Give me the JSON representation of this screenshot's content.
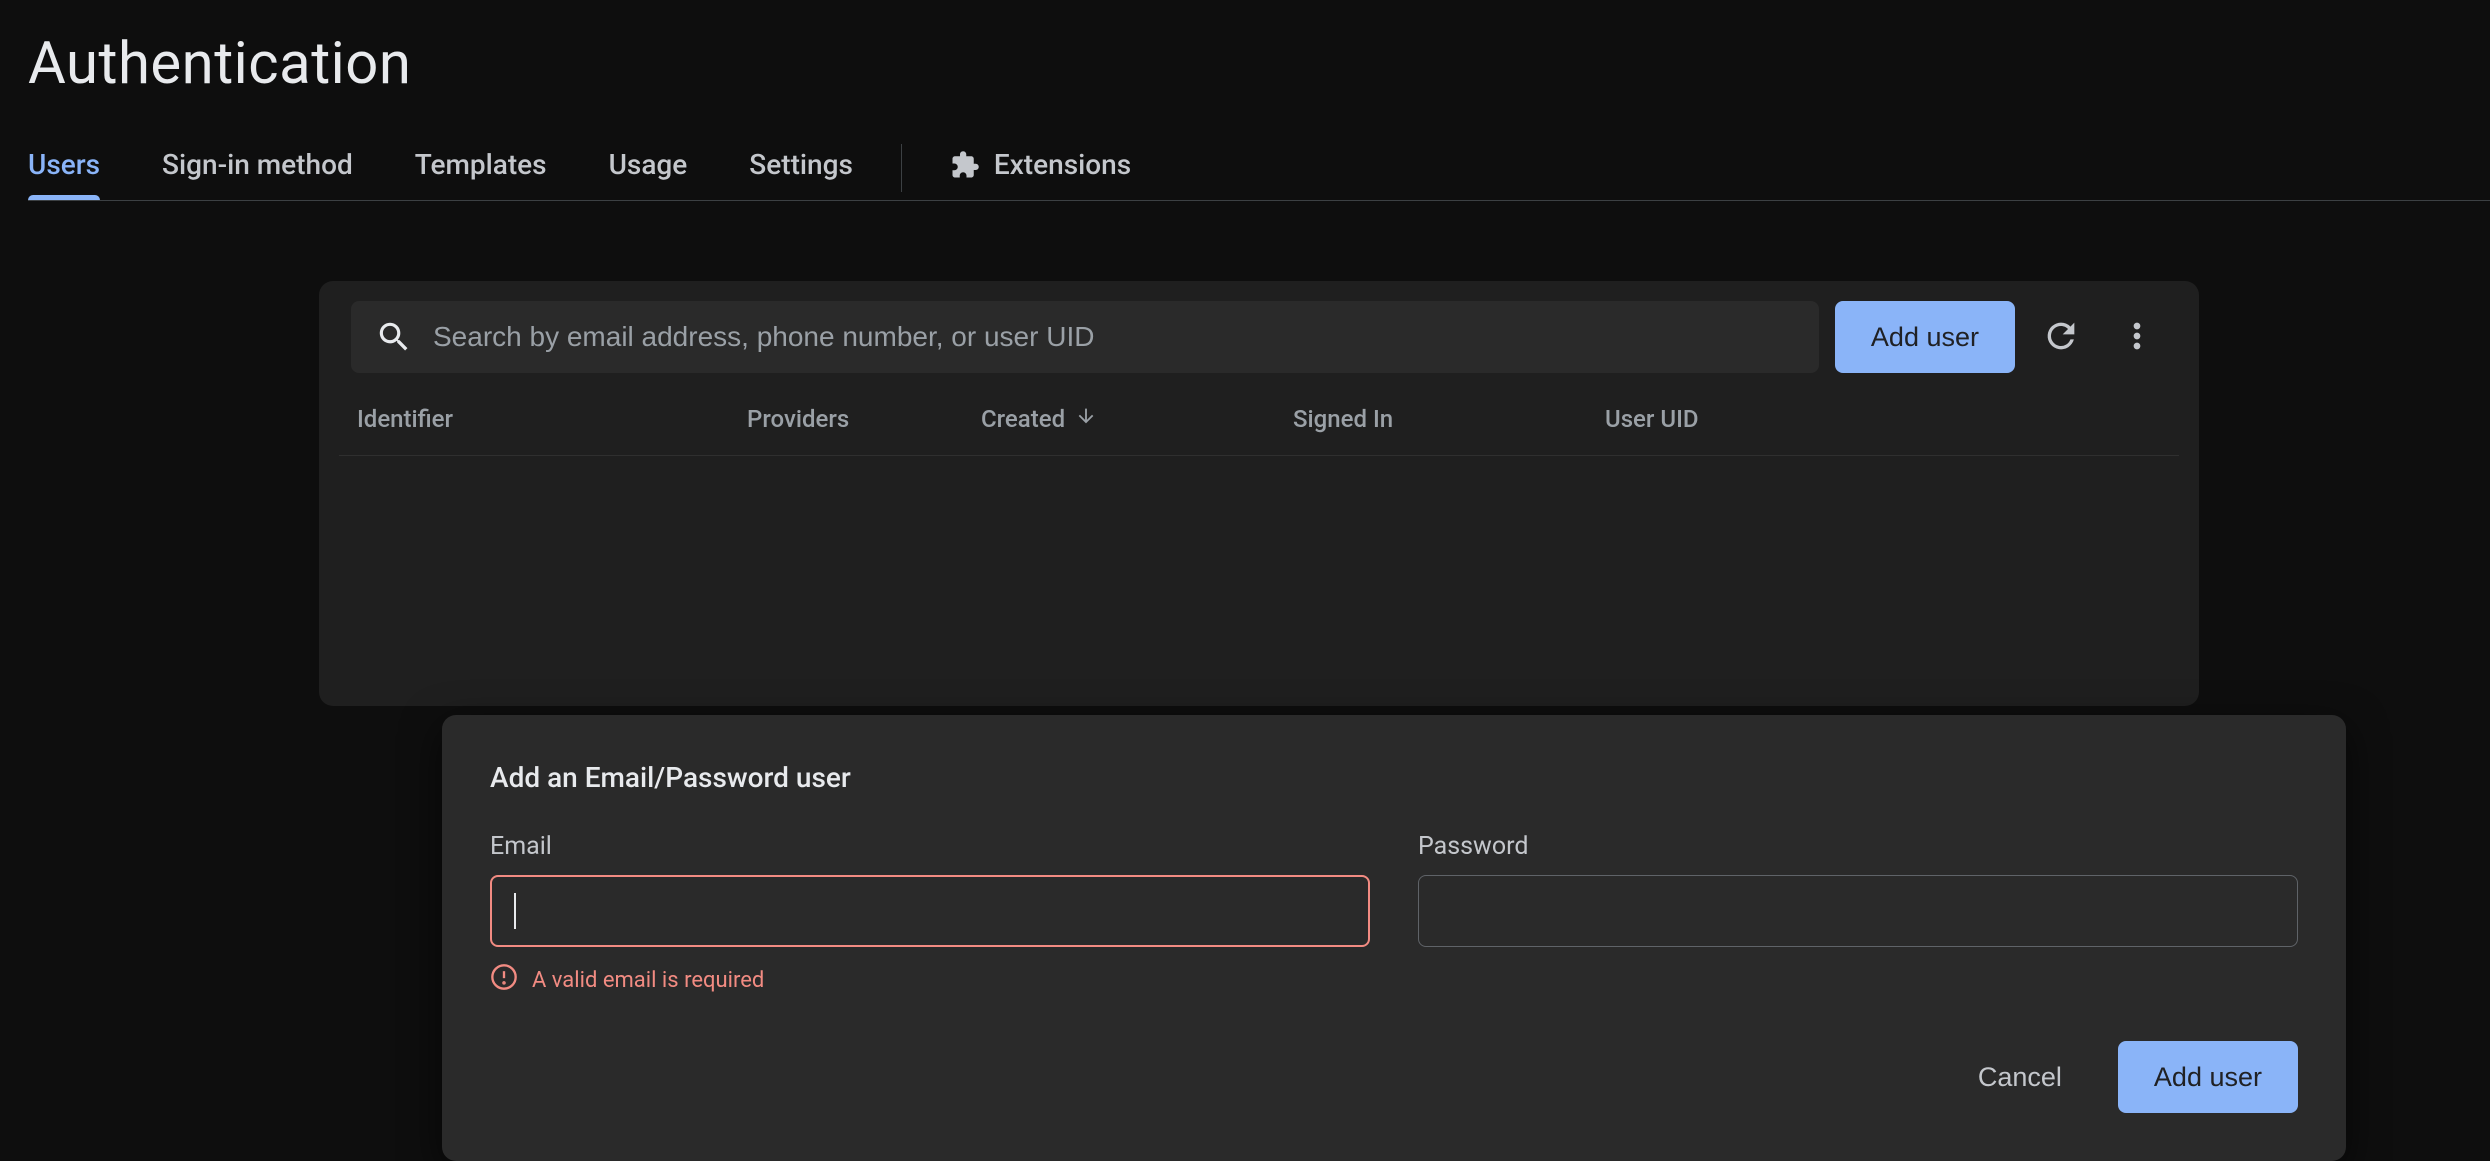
{
  "header": {
    "title": "Authentication"
  },
  "tabs": [
    {
      "id": "users",
      "label": "Users",
      "active": true
    },
    {
      "id": "signin",
      "label": "Sign-in method",
      "active": false
    },
    {
      "id": "templates",
      "label": "Templates",
      "active": false
    },
    {
      "id": "usage",
      "label": "Usage",
      "active": false
    },
    {
      "id": "settings",
      "label": "Settings",
      "active": false
    },
    {
      "id": "extensions",
      "label": "Extensions",
      "active": false,
      "icon": "extensions-icon"
    }
  ],
  "toolbar": {
    "search_placeholder": "Search by email address, phone number, or user UID",
    "add_user_label": "Add user",
    "refresh_icon": "refresh-icon",
    "overflow_icon": "more-vert-icon"
  },
  "table": {
    "columns": {
      "identifier": "Identifier",
      "providers": "Providers",
      "created": "Created",
      "signed_in": "Signed In",
      "user_uid": "User UID"
    },
    "sorted_column": "created",
    "sort_direction": "desc",
    "rows": []
  },
  "dialog": {
    "title": "Add an Email/Password user",
    "email_label": "Email",
    "email_value": "",
    "email_error": "A valid email is required",
    "password_label": "Password",
    "password_value": "",
    "cancel_label": "Cancel",
    "submit_label": "Add user"
  },
  "colors": {
    "accent": "#8ab4f8",
    "error": "#f28b82",
    "bg": "#0e0e0e",
    "panel": "#1f1f1f",
    "dialog": "#2a2a2a"
  }
}
